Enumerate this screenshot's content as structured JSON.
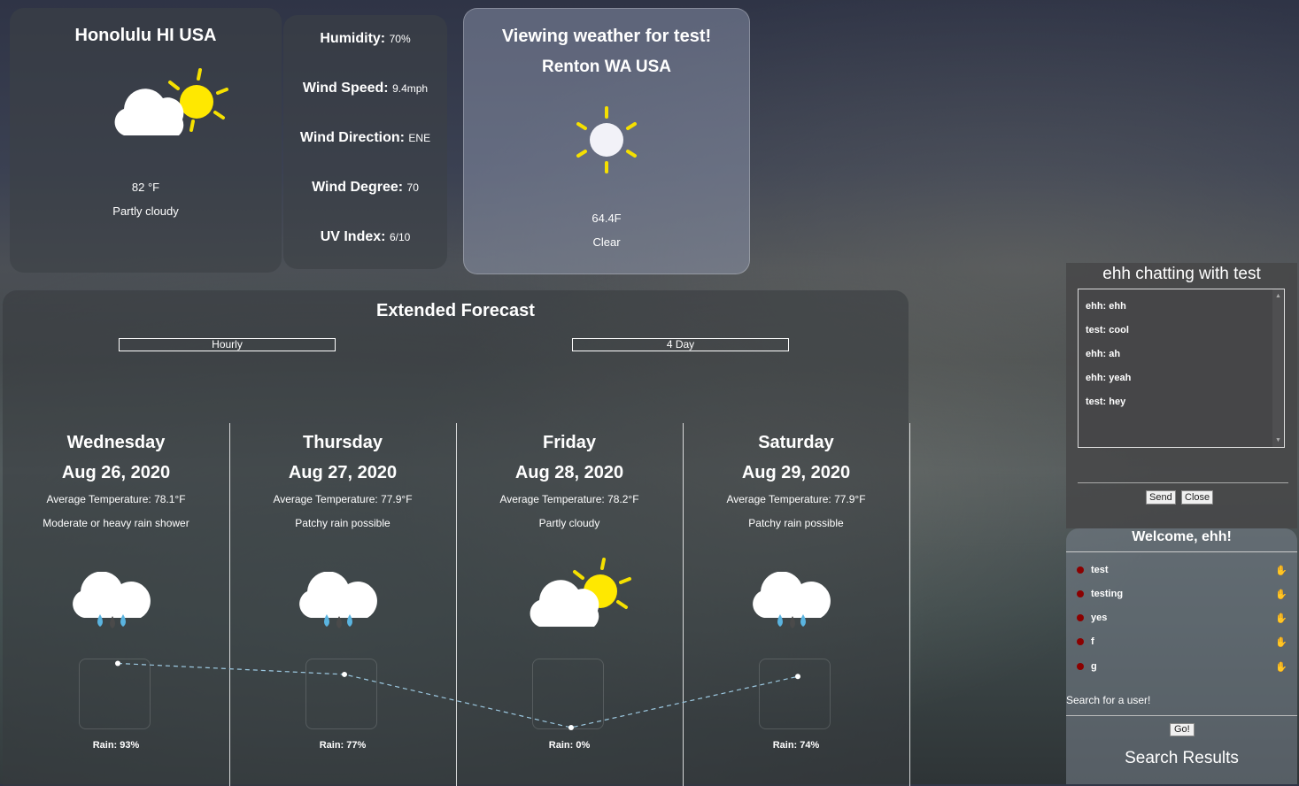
{
  "current": {
    "location": "Honolulu HI USA",
    "temperature": "82 °F",
    "condition": "Partly cloudy",
    "icon": "partly-cloudy-icon"
  },
  "details": {
    "humidity_label": "Humidity:",
    "humidity": "70%",
    "wind_speed_label": "Wind Speed:",
    "wind_speed": "9.4mph",
    "wind_direction_label": "Wind Direction:",
    "wind_direction": "ENE",
    "wind_degree_label": "Wind Degree:",
    "wind_degree": "70",
    "uv_label": "UV Index:",
    "uv": "6/10"
  },
  "viewing": {
    "title": "Viewing weather for test!",
    "location": "Renton WA USA",
    "temperature": "64.4F",
    "condition": "Clear",
    "icon": "sun-icon"
  },
  "forecast": {
    "heading": "Extended Forecast",
    "hourly_label": "Hourly",
    "fourday_label": "4 Day",
    "days": [
      {
        "name": "Wednesday",
        "date": "Aug 26, 2020",
        "avg": "Average Temperature: 78.1°F",
        "condition": "Moderate or heavy rain shower",
        "rain": "Rain: 93%",
        "rain_pct": 93,
        "icon": "rain-cloud-icon"
      },
      {
        "name": "Thursday",
        "date": "Aug 27, 2020",
        "avg": "Average Temperature: 77.9°F",
        "condition": "Patchy rain possible",
        "rain": "Rain: 77%",
        "rain_pct": 77,
        "icon": "rain-cloud-icon"
      },
      {
        "name": "Friday",
        "date": "Aug 28, 2020",
        "avg": "Average Temperature: 78.2°F",
        "condition": "Partly cloudy",
        "rain": "Rain: 0%",
        "rain_pct": 0,
        "icon": "partly-cloudy-icon"
      },
      {
        "name": "Saturday",
        "date": "Aug 29, 2020",
        "avg": "Average Temperature: 77.9°F",
        "condition": "Patchy rain possible",
        "rain": "Rain: 74%",
        "rain_pct": 74,
        "icon": "rain-cloud-icon"
      }
    ]
  },
  "chat": {
    "title": "ehh chatting with test",
    "messages": [
      "ehh: ehh",
      "test: cool",
      "ehh: ah",
      "ehh: yeah",
      "test: hey"
    ],
    "send_label": "Send",
    "close_label": "Close"
  },
  "users": {
    "welcome": "Welcome, ehh!",
    "list": [
      "test",
      "testing",
      "yes",
      "f",
      "g"
    ],
    "status_color": "#8b0000",
    "wave_icon": "wave-hand-icon",
    "search_label": "Search for a user!",
    "go_label": "Go!",
    "results_title": "Search Results"
  }
}
